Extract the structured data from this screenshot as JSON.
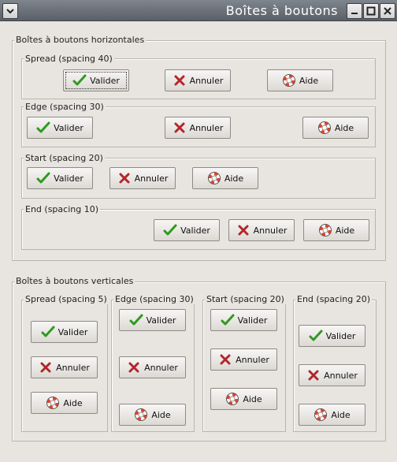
{
  "window": {
    "title": "Boîtes à boutons"
  },
  "horizontal": {
    "label": "Boîtes à boutons horizontales",
    "groups": [
      {
        "label": "Spread (spacing 40)"
      },
      {
        "label": "Edge (spacing 30)"
      },
      {
        "label": "Start (spacing 20)"
      },
      {
        "label": "End (spacing 10)"
      }
    ]
  },
  "vertical": {
    "label": "Boîtes à boutons verticales",
    "groups": [
      {
        "label": "Spread (spacing 5)"
      },
      {
        "label": "Edge (spacing 30)"
      },
      {
        "label": "Start (spacing 20)"
      },
      {
        "label": "End (spacing 20)"
      }
    ]
  },
  "buttons": {
    "ok": "Valider",
    "cancel": "Annuler",
    "help": "Aide"
  },
  "icons": {
    "ok": "check-icon",
    "cancel": "cross-icon",
    "help": "lifebuoy-icon"
  },
  "colors": {
    "titlebar": "#6b7079",
    "check": "#2f9a1f",
    "cross": "#b3262a",
    "lifebuoy": "#d9442b"
  }
}
